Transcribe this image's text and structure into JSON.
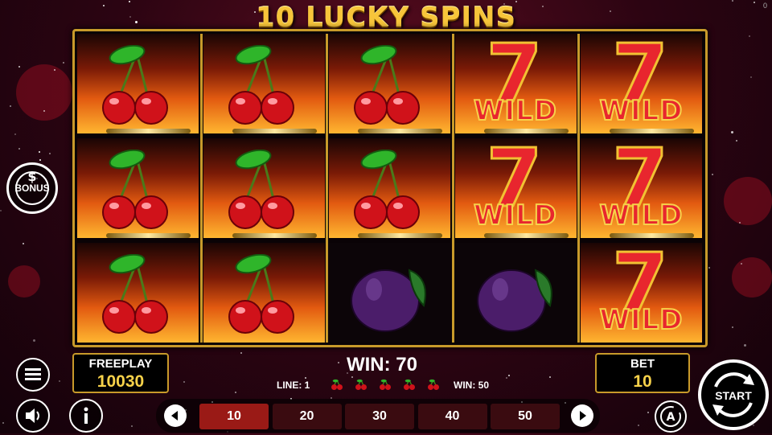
{
  "title": "10 LUCKY SPINS",
  "reels": [
    [
      "cherry",
      "cherry",
      "cherry"
    ],
    [
      "cherry",
      "cherry",
      "cherry"
    ],
    [
      "cherry",
      "cherry",
      "plum"
    ],
    [
      "wild",
      "wild",
      "plum"
    ],
    [
      "wild",
      "wild",
      "wild"
    ]
  ],
  "wild_label": "WILD",
  "freeplay": {
    "label": "FREEPLAY",
    "value": "10030"
  },
  "bet": {
    "label": "BET",
    "value": "10"
  },
  "win": {
    "text": "WIN: 70"
  },
  "line_win": {
    "line": "LINE: 1",
    "win": "WIN: 50",
    "symbol_count": 5
  },
  "bet_options": [
    "10",
    "20",
    "30",
    "40",
    "50"
  ],
  "selected_bet": "10",
  "buttons": {
    "start": "START",
    "bonus": "BONUS"
  },
  "icons": {
    "menu": "hamburger-icon",
    "sound": "speaker-icon",
    "info": "info-icon",
    "autoplay": "autoplay-icon",
    "prev": "chevron-left-icon",
    "next": "chevron-right-icon"
  },
  "colors": {
    "gold": "#f7d24a",
    "frame": "#c89a2a",
    "active_bet": "#9a1a16",
    "wild_red": "#e8262e"
  }
}
